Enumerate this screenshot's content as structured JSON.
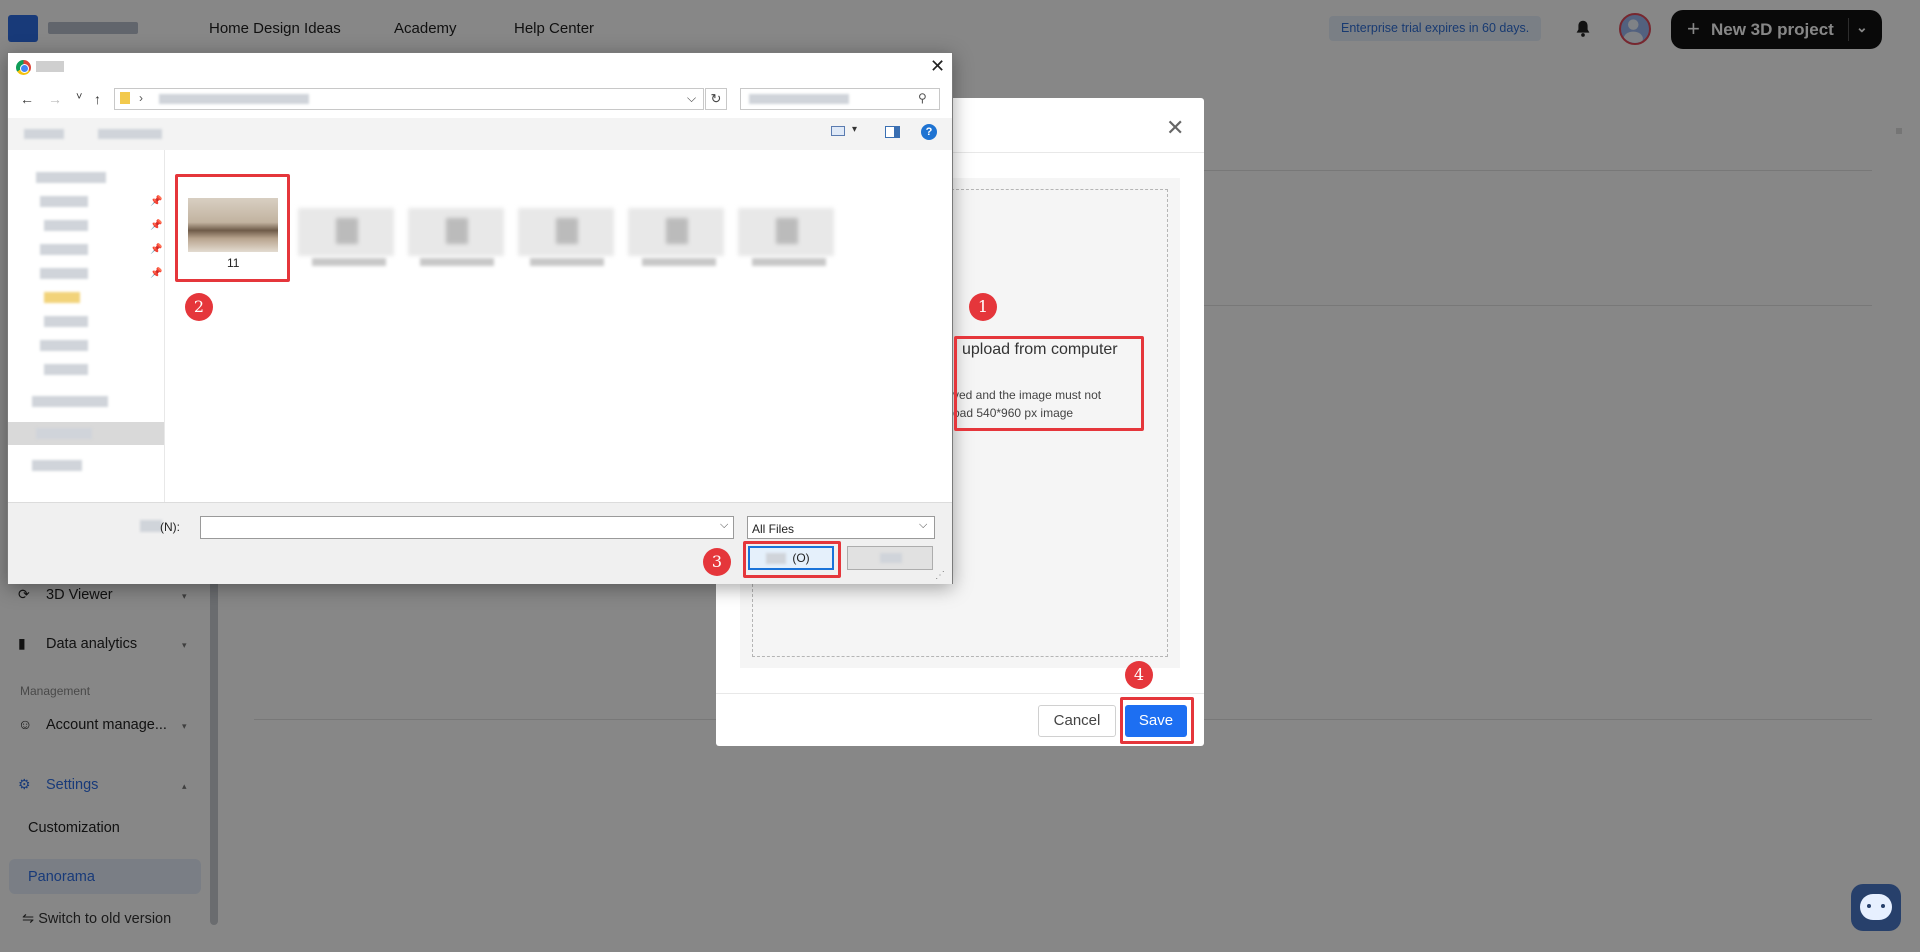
{
  "topbar": {
    "nav": [
      "Home Design Ideas",
      "Academy",
      "Help Center"
    ],
    "trial_notice": "Enterprise trial expires in 60 days.",
    "new_project_label": "New 3D project",
    "new_project_plus": "+",
    "new_project_chevron": "⌄"
  },
  "sidebar": {
    "viewer_label": "3D Viewer",
    "analytics_label": "Data analytics",
    "management_header": "Management",
    "account_label": "Account manage...",
    "settings_label": "Settings",
    "customization_label": "Customization",
    "panorama_label": "Panorama",
    "old_version_label": "Switch to old version",
    "caret_down": "▾",
    "caret_up": "▴"
  },
  "modal": {
    "close_glyph": "✕",
    "upload_title": "upload from computer",
    "upload_line1": "ved and the image must not",
    "upload_line2": "oad 540*960 px image",
    "cancel_label": "Cancel",
    "save_label": "Save"
  },
  "annotations": [
    "1",
    "2",
    "3",
    "4"
  ],
  "file_dialog": {
    "close_glyph": "✕",
    "back": "←",
    "forward": "→",
    "recent": "˅",
    "up": "↑",
    "path_sep": "›",
    "path_caret": "⌵",
    "refresh": "↻",
    "search_glyph": "⚲",
    "view_caret": "▾",
    "help_glyph": "?",
    "pin_glyph": "📌",
    "filename_label": "(N):",
    "filename_value": "",
    "filetype": "All Files",
    "filetype_caret": "⌵",
    "open_label": "(O)",
    "grip": "⋰",
    "selected_file_name": "11"
  },
  "colors": {
    "accent": "#1d6ff2",
    "annotation": "#e5363b",
    "overlay": "rgba(0,0,0,0.47)"
  }
}
